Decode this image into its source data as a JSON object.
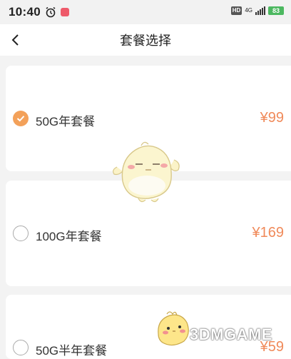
{
  "status_bar": {
    "time": "10:40",
    "network": "4G",
    "battery": "83"
  },
  "nav": {
    "title": "套餐选择"
  },
  "plans": [
    {
      "name": "50G年套餐",
      "price": "¥99",
      "selected": true
    },
    {
      "name": "100G年套餐",
      "price": "¥169",
      "selected": false
    },
    {
      "name": "50G半年套餐",
      "price": "¥59",
      "selected": false
    }
  ],
  "watermark": {
    "text": "3DMGAME"
  },
  "colors": {
    "accent": "#f3a15a",
    "price": "#f08a5a",
    "background": "#f3f3f3"
  }
}
